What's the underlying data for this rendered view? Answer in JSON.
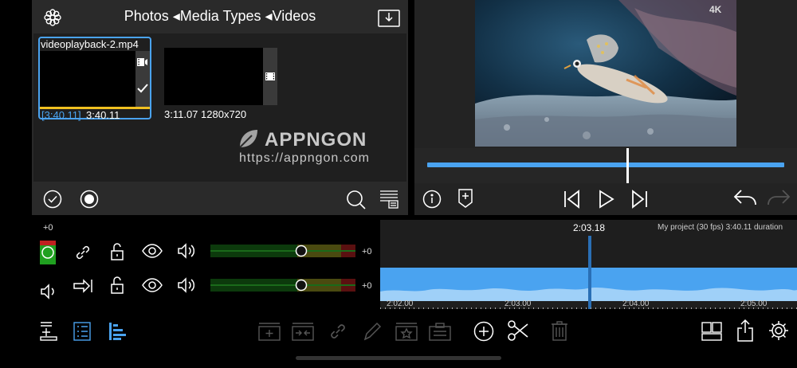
{
  "browser": {
    "breadcrumb": "Photos ◂Media Types ◂Videos",
    "clips": [
      {
        "name": "videoplayback-2.mp4",
        "info_in": "3:40.11",
        "info_out": "3:40.11",
        "selected": true
      },
      {
        "name": "",
        "info": "3:11.07  1280x720",
        "selected": false
      }
    ]
  },
  "watermark": {
    "brand": "APPNGON",
    "url": "https://appngon.com"
  },
  "preview": {
    "badge": "4K"
  },
  "tracks": {
    "gain_top": "+0",
    "track1_gain": "+0",
    "track2_gain": "+0"
  },
  "timeline": {
    "playhead_time": "2:03.18",
    "project_info": "My project (30 fps)  3:40.11 duration",
    "ticks": [
      "2:02.00",
      "2:03.00",
      "2:04.00",
      "2:05.00"
    ]
  },
  "colors": {
    "accent": "#4aa3f0",
    "selection": "#4aa3f0",
    "yellow": "#f0c020"
  }
}
